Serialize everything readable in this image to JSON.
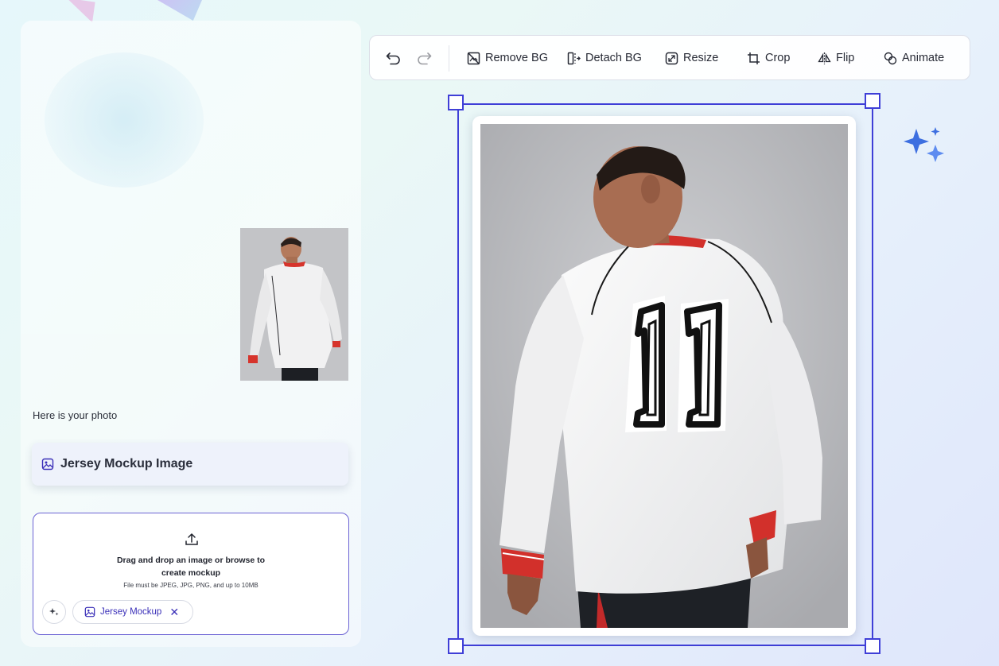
{
  "canvas": {
    "caption": "Here is your photo",
    "mockup_card": {
      "title": "Jersey Mockup Image",
      "icon": "image-icon"
    },
    "upload": {
      "line1": "Drag and drop an image or browse to",
      "line2": "create mockup",
      "note": "File must be JPEG, JPG, PNG, and up to 10MB",
      "chip_label": "Jersey Mockup",
      "chip_close": "✕"
    }
  },
  "toolbar": {
    "tools": [
      {
        "label": "Remove BG",
        "icon": "remove-bg-icon"
      },
      {
        "label": "Detach BG",
        "icon": "detach-bg-icon"
      },
      {
        "label": "Resize",
        "icon": "resize-icon"
      },
      {
        "label": "Crop",
        "icon": "crop-icon"
      },
      {
        "label": "Flip",
        "icon": "flip-icon"
      },
      {
        "label": "Animate",
        "icon": "animate-icon"
      }
    ]
  },
  "preview": {
    "jersey_number": "11"
  },
  "colors": {
    "accent": "#3f3fd7",
    "chip_text": "#3a2fb8",
    "sparkle": "#3d6fe0"
  }
}
